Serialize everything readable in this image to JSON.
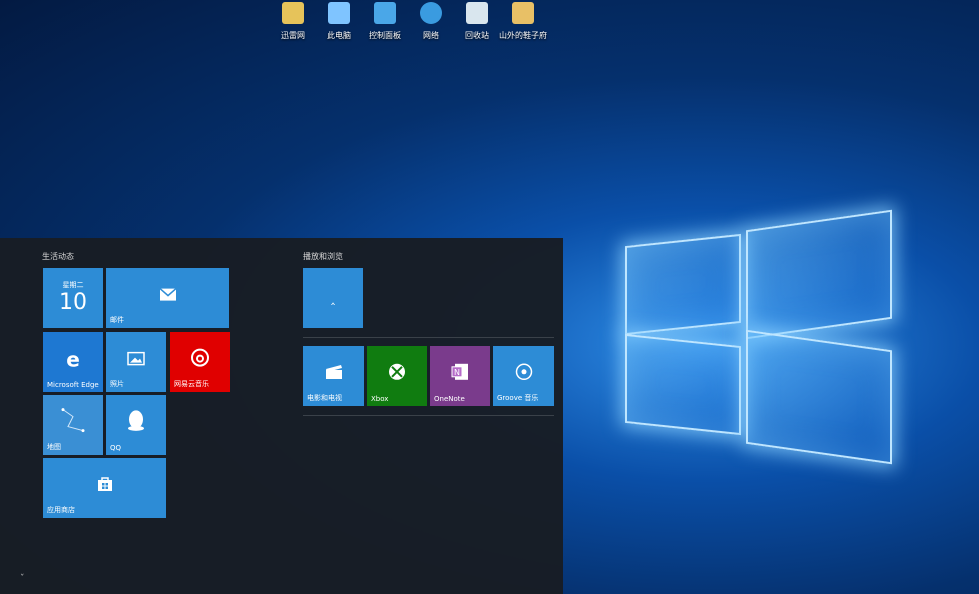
{
  "desktop": {
    "icons": [
      {
        "label": "迅雷网",
        "icon": "folder-doc-icon",
        "color": "#e6c35a"
      },
      {
        "label": "此电脑",
        "icon": "computer-icon",
        "color": "#7fc4ff"
      },
      {
        "label": "控制面板",
        "icon": "control-panel-icon",
        "color": "#4aa7e8"
      },
      {
        "label": "网络",
        "icon": "network-icon",
        "color": "#3a9be0"
      },
      {
        "label": "回收站",
        "icon": "recycle-bin-icon",
        "color": "#d9e6ee"
      },
      {
        "label": "山外的鞋子府",
        "icon": "user-folder-icon",
        "color": "#e8c066"
      }
    ]
  },
  "start_menu": {
    "group1_title": "生活动态",
    "group2_title": "播放和浏览",
    "tiles": {
      "calendar_day": "星期二",
      "calendar_date": "10",
      "mail": "邮件",
      "edge": "Microsoft Edge",
      "photos": "照片",
      "netease": "网易云音乐",
      "maps": "地图",
      "qq": "QQ",
      "store": "应用商店",
      "movies": "电影和电视",
      "xbox": "Xbox",
      "onenote": "OneNote",
      "groove": "Groove 音乐"
    },
    "colors": {
      "tile_blue": "#2d8cd6",
      "netease_red": "#e00000",
      "xbox_green": "#107c10",
      "onenote_purple": "#7a3b8c"
    }
  }
}
